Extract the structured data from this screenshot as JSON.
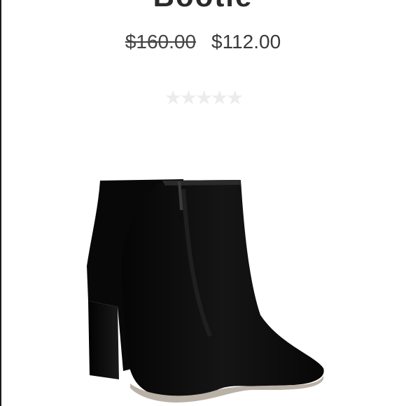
{
  "product": {
    "title": "Bootie",
    "price_original": "$160.00",
    "price_sale": "$112.00",
    "rating_stars": "★★★★★",
    "rating_value": 0,
    "rating_max": 5,
    "image_icon": "black-suede-ankle-boot-image"
  },
  "colors": {
    "text": "#3a3a3a",
    "star_empty": "#ececec",
    "boot": "#0d0d0d"
  }
}
